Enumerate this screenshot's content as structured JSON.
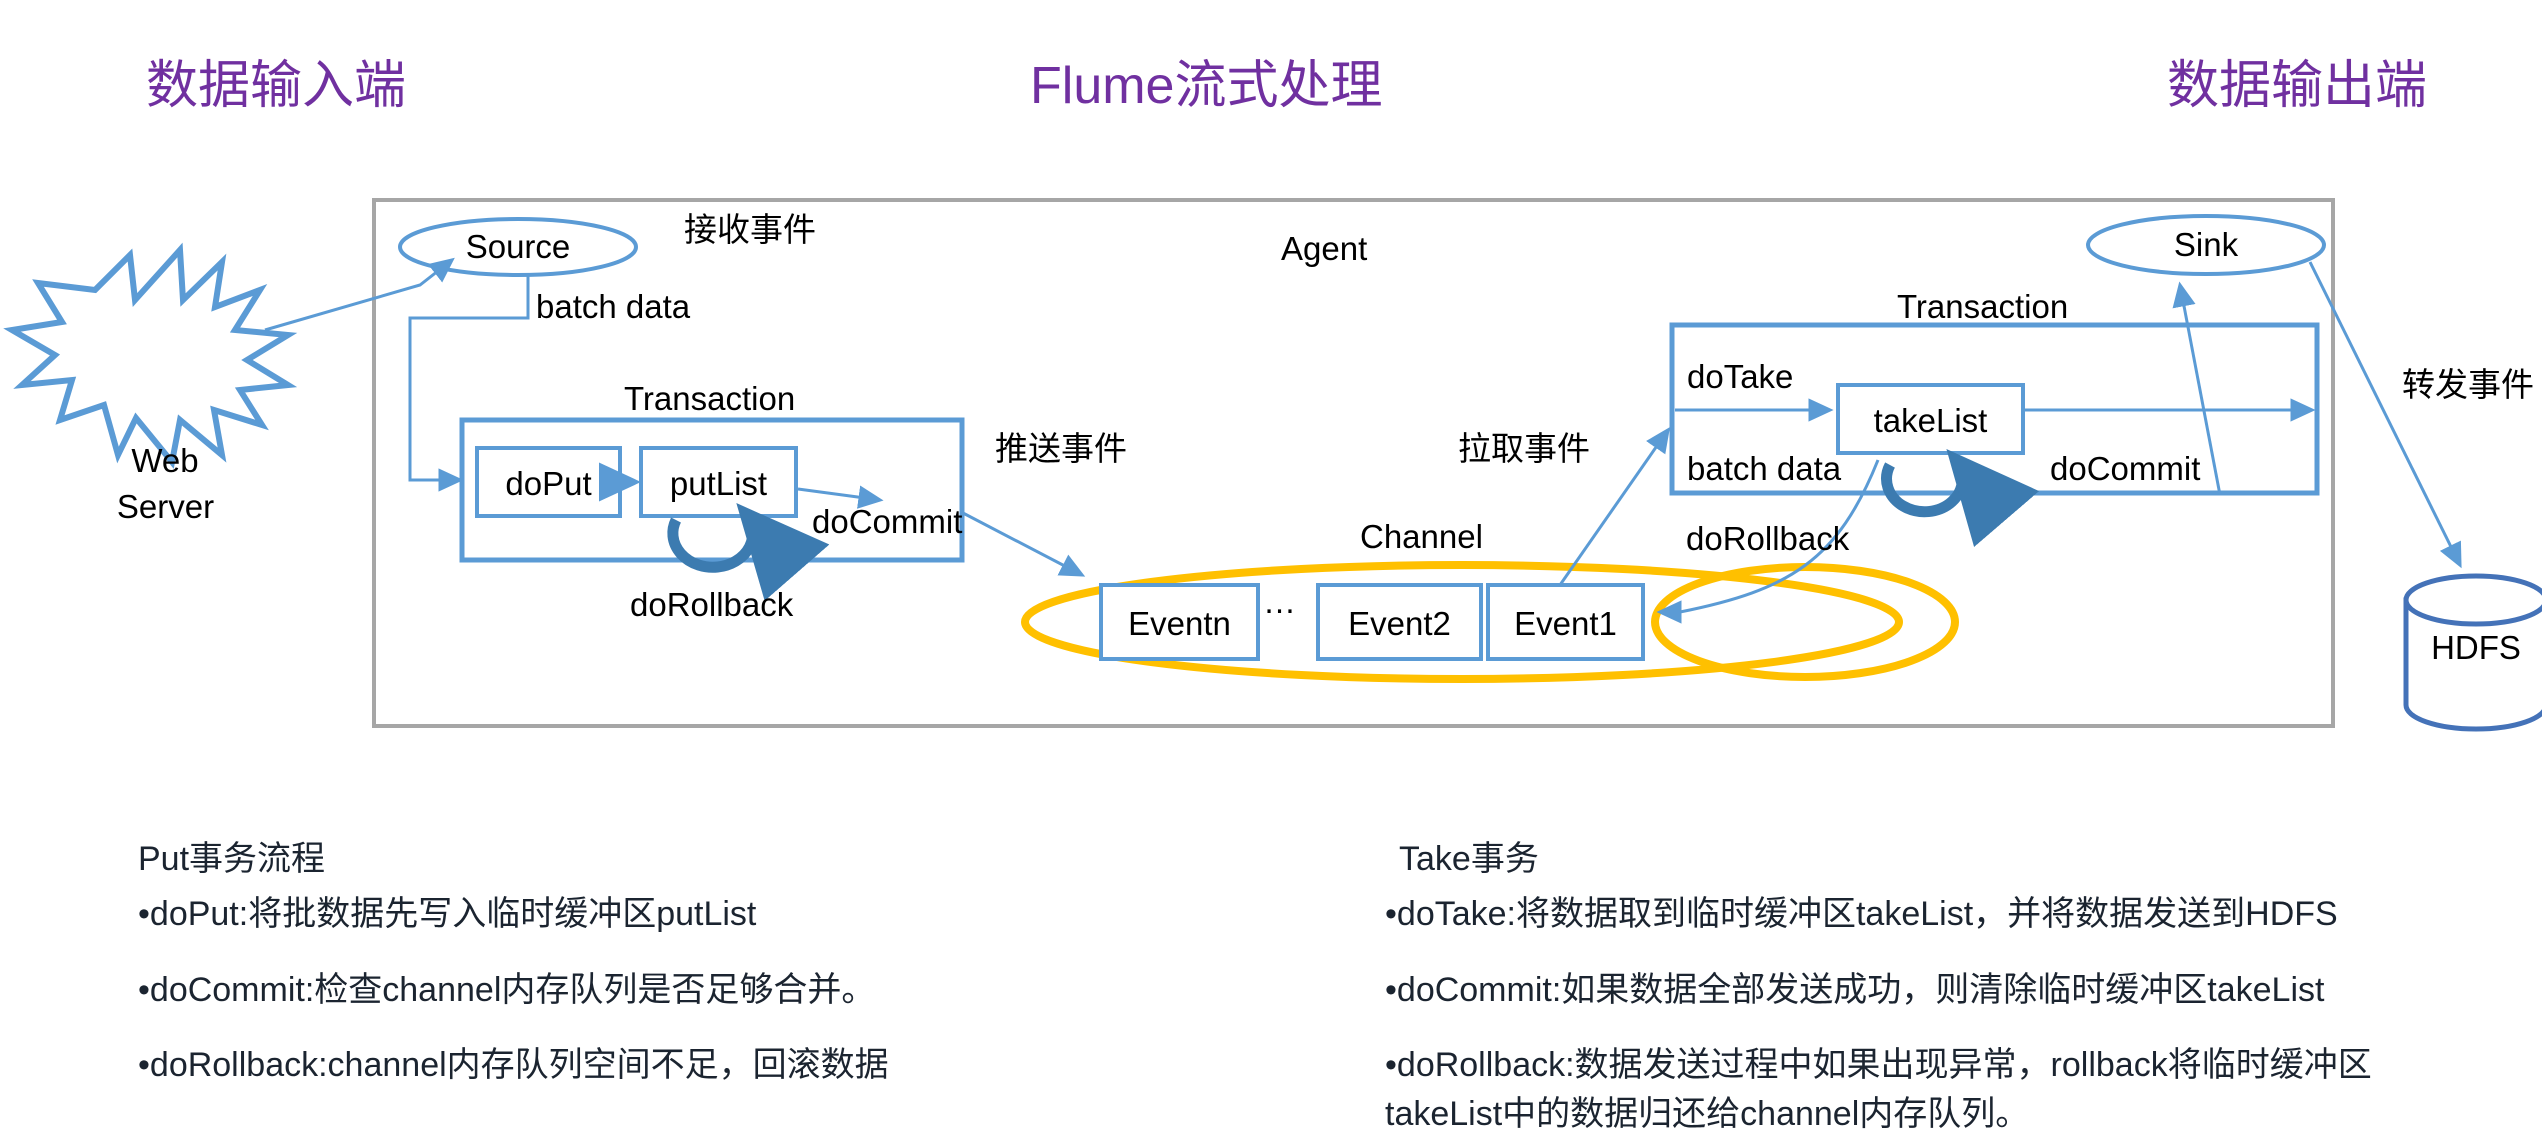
{
  "titles": {
    "left": "数据输入端",
    "center": "Flume流式处理",
    "right": "数据输出端",
    "color": "#7030A0"
  },
  "colors": {
    "flow_blue": "#5B9BD5",
    "channel_yellow": "#FFC000",
    "agent_border": "#A6A6A6",
    "text": "#000000",
    "body_text": "#1B2430"
  },
  "diagram": {
    "agent_label": "Agent",
    "web_server": "Web\nServer",
    "web_server_line1": "Web",
    "web_server_line2": "Server",
    "source": "Source",
    "sink": "Sink",
    "hdfs": "HDFS",
    "channel": "Channel",
    "recv_event": "接收事件",
    "push_event": "推送事件",
    "pull_event": "拉取事件",
    "forward_event": "转发事件",
    "batch_data_left": "batch data",
    "batch_data_right": "batch data",
    "put_transaction": {
      "title": "Transaction",
      "step1": "doPut",
      "step2": "putList",
      "commit": "doCommit",
      "rollback": "doRollback"
    },
    "take_transaction": {
      "title": "Transaction",
      "step1": "doTake",
      "step2": "takeList",
      "commit": "doCommit",
      "rollback": "doRollback"
    },
    "events": [
      "Eventn",
      "Event2",
      "Event1"
    ],
    "events_ellipsis": "…"
  },
  "notes": {
    "put": {
      "heading": "Put事务流程",
      "lines": [
        "•doPut:将批数据先写入临时缓冲区putList",
        "•doCommit:检查channel内存队列是否足够合并。",
        "•doRollback:channel内存队列空间不足，回滚数据"
      ]
    },
    "take": {
      "heading": "Take事务",
      "lines": [
        "•doTake:将数据取到临时缓冲区takeList，并将数据发送到HDFS",
        "•doCommit:如果数据全部发送成功，则清除临时缓冲区takeList",
        "•doRollback:数据发送过程中如果出现异常，rollback将临时缓冲区takeList中的数据归还给channel内存队列。"
      ]
    }
  }
}
